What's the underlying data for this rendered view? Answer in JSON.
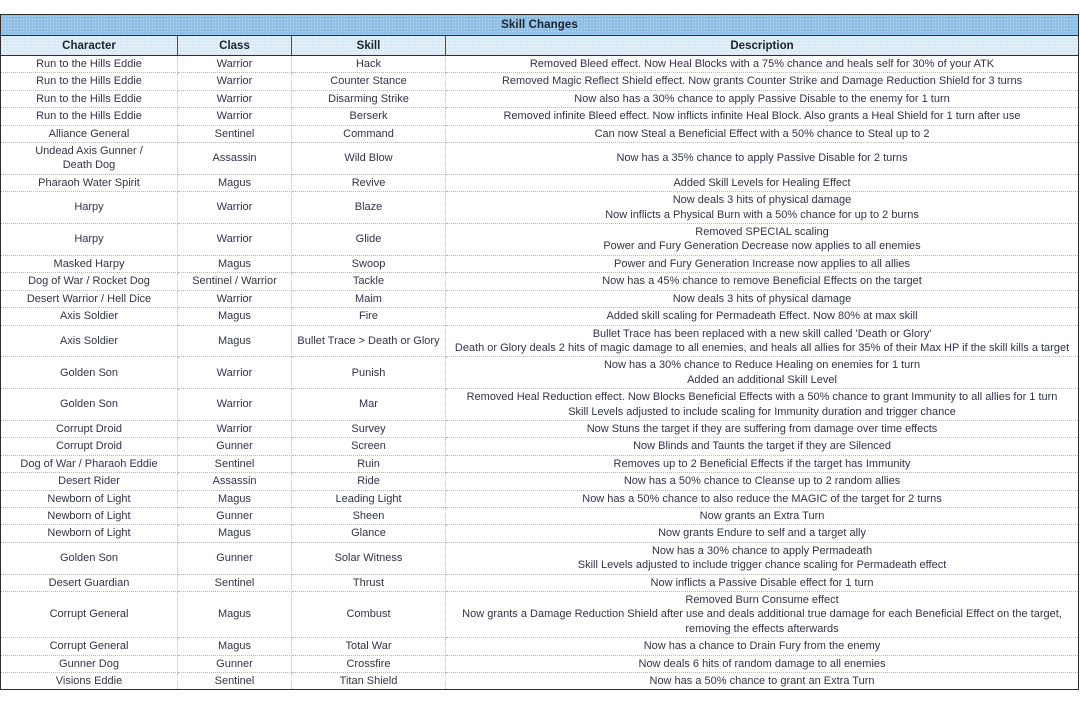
{
  "table": {
    "title": "Skill Changes",
    "columns": [
      "Character",
      "Class",
      "Skill",
      "Description"
    ],
    "rows": [
      {
        "character": "Run to the Hills Eddie",
        "class": "Warrior",
        "skill": "Hack",
        "description": "Removed Bleed effect. Now Heal Blocks with a 75% chance and heals self for 30% of your ATK"
      },
      {
        "character": "Run to the Hills Eddie",
        "class": "Warrior",
        "skill": "Counter Stance",
        "description": "Removed Magic Reflect Shield effect. Now grants Counter Strike and Damage Reduction Shield for 3 turns"
      },
      {
        "character": "Run to the Hills Eddie",
        "class": "Warrior",
        "skill": "Disarming Strike",
        "description": "Now also has a 30% chance to apply Passive Disable to the enemy for 1 turn"
      },
      {
        "character": "Run to the Hills Eddie",
        "class": "Warrior",
        "skill": "Berserk",
        "description": "Removed infinite Bleed effect. Now inflicts infinite Heal Block. Also grants a Heal Shield for 1 turn after use"
      },
      {
        "character": "Alliance General",
        "class": "Sentinel",
        "skill": "Command",
        "description": "Can now Steal a Beneficial Effect with a 50% chance to Steal up to 2"
      },
      {
        "character": "Undead Axis Gunner /\nDeath Dog",
        "class": "Assassin",
        "skill": "Wild Blow",
        "description": "Now has a 35% chance to apply Passive Disable for 2 turns"
      },
      {
        "character": "Pharaoh Water Spirit",
        "class": "Magus",
        "skill": "Revive",
        "description": "Added Skill Levels for Healing Effect"
      },
      {
        "character": "Harpy",
        "class": "Warrior",
        "skill": "Blaze",
        "description": "Now deals 3 hits of physical damage\nNow inflicts a Physical Burn with a 50% chance for up to 2 burns"
      },
      {
        "character": "Harpy",
        "class": "Warrior",
        "skill": "Glide",
        "description": "Removed SPECIAL scaling\nPower and Fury Generation Decrease now applies to all enemies"
      },
      {
        "character": "Masked Harpy",
        "class": "Magus",
        "skill": "Swoop",
        "description": "Power and Fury Generation Increase now applies to all allies"
      },
      {
        "character": "Dog of War / Rocket Dog",
        "class": "Sentinel / Warrior",
        "skill": "Tackle",
        "description": "Now has a 45% chance to remove Beneficial Effects on the target"
      },
      {
        "character": "Desert Warrior / Hell Dice",
        "class": "Warrior",
        "skill": "Maim",
        "description": "Now deals 3 hits of physical damage"
      },
      {
        "character": "Axis Soldier",
        "class": "Magus",
        "skill": "Fire",
        "description": "Added skill scaling for Permadeath Effect. Now 80% at max skill"
      },
      {
        "character": "Axis Soldier",
        "class": "Magus",
        "skill": "Bullet Trace > Death or Glory",
        "description": "Bullet Trace has been replaced with a new skill called 'Death or Glory'\nDeath or Glory deals 2 hits of magic damage to all enemies, and heals all allies for 35% of their Max HP if the skill kills a target"
      },
      {
        "character": "Golden Son",
        "class": "Warrior",
        "skill": "Punish",
        "description": "Now has a 30% chance to Reduce Healing on enemies for 1 turn\nAdded an additional Skill Level"
      },
      {
        "character": "Golden Son",
        "class": "Warrior",
        "skill": "Mar",
        "description": "Removed Heal Reduction effect. Now Blocks Beneficial Effects with a 50% chance to grant Immunity to all allies for 1 turn\nSkill Levels adjusted to include scaling for Immunity duration and trigger chance"
      },
      {
        "character": "Corrupt Droid",
        "class": "Warrior",
        "skill": "Survey",
        "description": "Now Stuns the target if they are suffering from damage over time effects"
      },
      {
        "character": "Corrupt Droid",
        "class": "Gunner",
        "skill": "Screen",
        "description": "Now Blinds and Taunts the target if they are Silenced"
      },
      {
        "character": "Dog of War / Pharaoh Eddie",
        "class": "Sentinel",
        "skill": "Ruin",
        "description": "Removes up to 2 Beneficial Effects if the target has Immunity"
      },
      {
        "character": "Desert Rider",
        "class": "Assassin",
        "skill": "Ride",
        "description": "Now has a 50% chance to Cleanse up to 2 random allies"
      },
      {
        "character": "Newborn of Light",
        "class": "Magus",
        "skill": "Leading Light",
        "description": "Now has a 50% chance to also reduce the MAGIC of the target for 2 turns"
      },
      {
        "character": "Newborn of Light",
        "class": "Gunner",
        "skill": "Sheen",
        "description": "Now grants an Extra Turn"
      },
      {
        "character": "Newborn of Light",
        "class": "Magus",
        "skill": "Glance",
        "description": "Now grants Endure to self and a target ally"
      },
      {
        "character": "Golden Son",
        "class": "Gunner",
        "skill": "Solar Witness",
        "description": "Now has a 30% chance to apply Permadeath\nSkill Levels adjusted to include trigger chance scaling for Permadeath effect"
      },
      {
        "character": "Desert Guardian",
        "class": "Sentinel",
        "skill": "Thrust",
        "description": "Now inflicts a Passive Disable effect for 1 turn"
      },
      {
        "character": "Corrupt General",
        "class": "Magus",
        "skill": "Combust",
        "description": "Removed Burn Consume effect\nNow grants a Damage Reduction Shield after use and deals additional true damage for each Beneficial Effect on the target,\nremoving the effects afterwards"
      },
      {
        "character": "Corrupt General",
        "class": "Magus",
        "skill": "Total War",
        "description": "Now has a chance to Drain Fury from the enemy"
      },
      {
        "character": "Gunner Dog",
        "class": "Gunner",
        "skill": "Crossfire",
        "description": "Now deals 6 hits of random damage to all enemies"
      },
      {
        "character": "Visions Eddie",
        "class": "Sentinel",
        "skill": "Titan Shield",
        "description": "Now has a 50% chance to grant an Extra Turn"
      }
    ]
  },
  "colors": {
    "title_bg": "#8fbfe4",
    "header_bg": "#dbeaf7",
    "border": "#2f2f2f",
    "text": "#33334a"
  }
}
